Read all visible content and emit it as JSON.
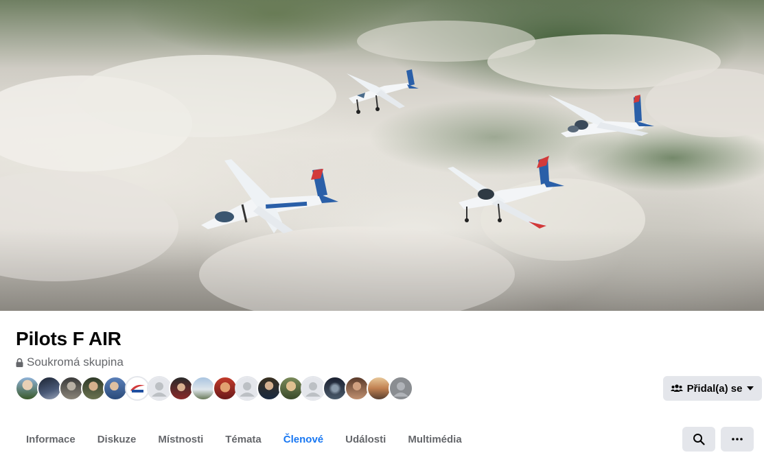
{
  "group": {
    "name": "Pilots F AIR",
    "privacy": "Soukromá skupina"
  },
  "members": {
    "avatars": [
      {
        "icon": "member-avatar-1"
      },
      {
        "icon": "member-avatar-2"
      },
      {
        "icon": "member-avatar-3"
      },
      {
        "icon": "member-avatar-4"
      },
      {
        "icon": "member-avatar-5"
      },
      {
        "icon": "member-avatar-6"
      },
      {
        "icon": "member-avatar-7"
      },
      {
        "icon": "member-avatar-8"
      },
      {
        "icon": "member-avatar-9"
      },
      {
        "icon": "member-avatar-10"
      },
      {
        "icon": "member-avatar-11"
      },
      {
        "icon": "member-avatar-12"
      },
      {
        "icon": "member-avatar-13"
      },
      {
        "icon": "member-avatar-14"
      },
      {
        "icon": "member-avatar-15"
      },
      {
        "icon": "member-avatar-16"
      },
      {
        "icon": "member-avatar-17"
      },
      {
        "icon": "member-avatar-18"
      }
    ]
  },
  "actions": {
    "join_label": "Přidal(a) se"
  },
  "tabs": [
    {
      "label": "Informace",
      "active": false
    },
    {
      "label": "Diskuze",
      "active": false
    },
    {
      "label": "Místnosti",
      "active": false
    },
    {
      "label": "Témata",
      "active": false
    },
    {
      "label": "Členové",
      "active": true
    },
    {
      "label": "Události",
      "active": false
    },
    {
      "label": "Multimédia",
      "active": false
    }
  ],
  "colors": {
    "accent": "#1877f2",
    "button_bg": "#e4e6eb",
    "secondary_text": "#65676b"
  }
}
